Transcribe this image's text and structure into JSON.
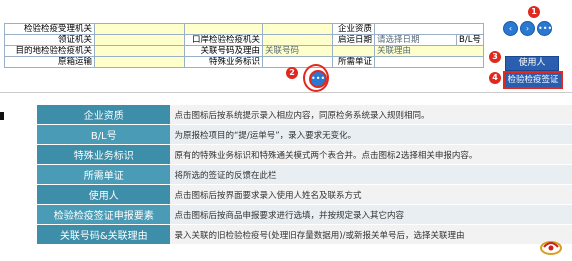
{
  "form": {
    "rows": [
      [
        {
          "t": "检验检疫受理机关",
          "k": "lbl"
        },
        {
          "t": "",
          "k": "val"
        },
        {
          "t": "",
          "k": "val"
        },
        {
          "t": "",
          "k": "val"
        },
        {
          "t": "企业资质",
          "k": "lbl"
        },
        {
          "t": "",
          "k": "val white"
        }
      ],
      [
        {
          "t": "领证机关",
          "k": "lbl"
        },
        {
          "t": "",
          "k": "val"
        },
        {
          "t": "口岸检验检疫机关",
          "k": "lbl"
        },
        {
          "t": "",
          "k": "val"
        },
        {
          "t": "启运日期",
          "k": "lbl"
        },
        {
          "t": "请选择日期",
          "k": "val white ph"
        },
        {
          "t": "B/L号",
          "k": "lbl"
        }
      ],
      [
        {
          "t": "目的地检验检疫机关",
          "k": "lbl"
        },
        {
          "t": "",
          "k": "val"
        },
        {
          "t": "关联号码及理由",
          "k": "lbl"
        },
        {
          "t": "关联号码",
          "k": "val ph"
        },
        {
          "t": "",
          "k": "val"
        },
        {
          "t": "关联理由",
          "k": "val ph"
        }
      ],
      [
        {
          "t": "原箱运输",
          "k": "lbl"
        },
        {
          "t": "",
          "k": "val"
        },
        {
          "t": "特殊业务标识",
          "k": "lbl"
        },
        {
          "t": "",
          "k": "val white"
        },
        {
          "t": "所需单证",
          "k": "lbl"
        },
        {
          "t": "",
          "k": "val white"
        }
      ]
    ],
    "btn_prev": "‹",
    "btn_next": "›",
    "btn_more": "•••",
    "badge1": "1",
    "badge2": "2",
    "badge3": "3",
    "badge4": "4",
    "btn_user": "使用人",
    "btn_apply": "检验检疫签证"
  },
  "desc": {
    "rows": [
      {
        "k": "企业资质",
        "v": "点击图标后按系统提示录入相应内容，同原检务系统录入规则相同。"
      },
      {
        "k": "B/L号",
        "v": "为原报检项目的“提/运单号”，录入要求无变化。"
      },
      {
        "k": "特殊业务标识",
        "v": "原有的特殊业务标识和特殊通关模式两个表合并。点击图标2选择相关申报内容。"
      },
      {
        "k": "所需单证",
        "v": "将所选的签证的反馈在此栏"
      },
      {
        "k": "使用人",
        "v": "点击图标后按界面要求录入使用人姓名及联系方式"
      },
      {
        "k": "检验检疫签证申报要素",
        "v": "点击图标后按商品申报要求进行选填，并按规定录入其它内容"
      },
      {
        "k": "关联号码&关联理由",
        "v": "录入关联的旧检验检疫号(处理旧存量数据用)/或新报关单号后，选择关联理由"
      }
    ]
  },
  "colors": {
    "accent": "#3d8ea8",
    "badge": "#e0281e",
    "button": "#2a5fb0",
    "field": "#ffffcc"
  }
}
